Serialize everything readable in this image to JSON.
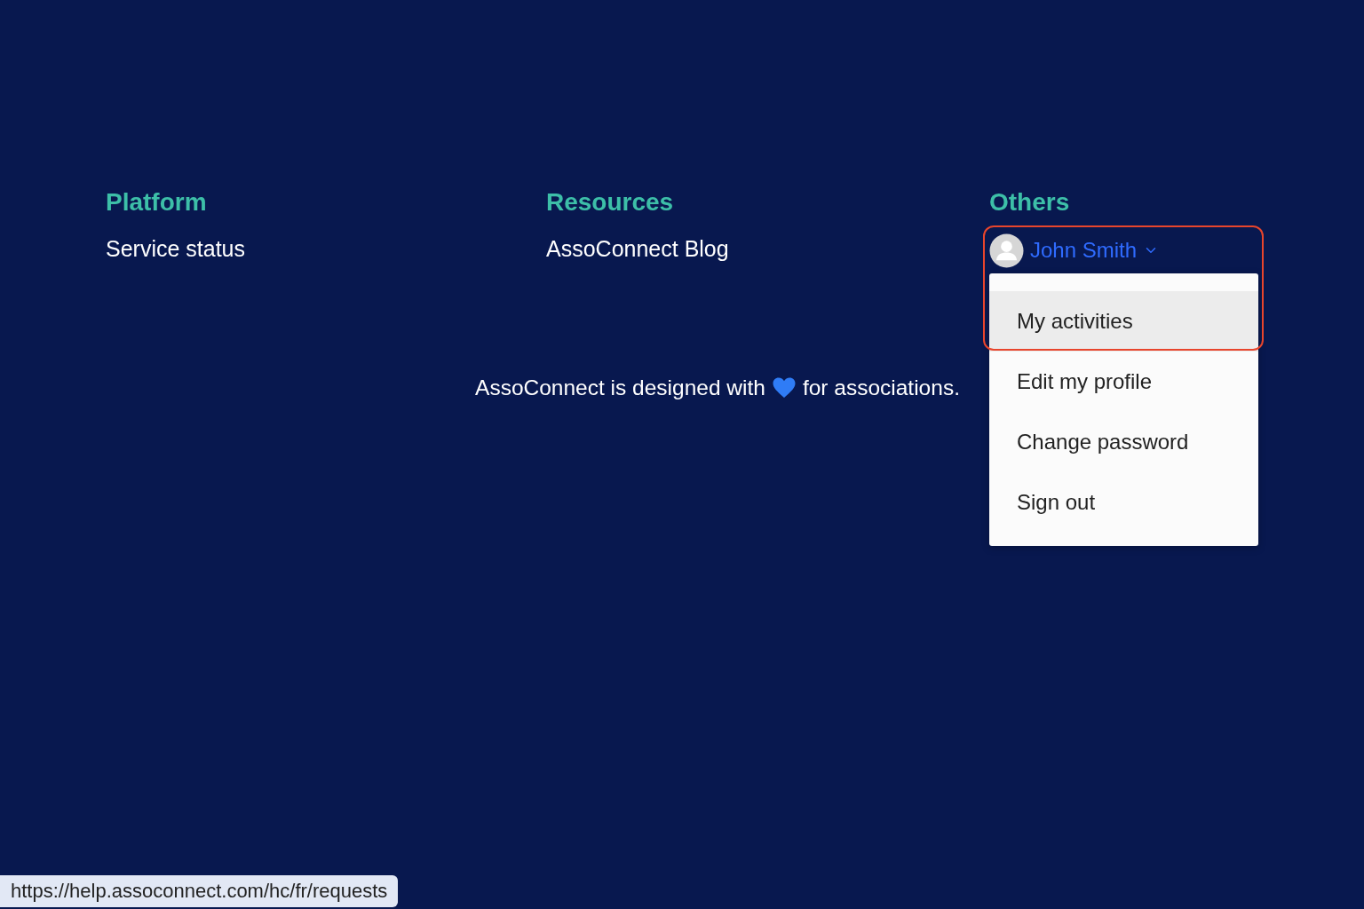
{
  "columns": [
    {
      "kind": "links",
      "heading": "Platform",
      "links": [
        "Service status"
      ]
    },
    {
      "kind": "links",
      "heading": "Resources",
      "links": [
        "AssoConnect Blog"
      ]
    },
    {
      "kind": "account",
      "heading": "Others",
      "user": {
        "name": "John Smith",
        "expanded": true,
        "highlighted": true
      },
      "menu": [
        {
          "label": "My activities",
          "selected": true
        },
        {
          "label": "Edit my profile",
          "selected": false
        },
        {
          "label": "Change password",
          "selected": false
        },
        {
          "label": "Sign out",
          "selected": false
        }
      ]
    }
  ],
  "tagline": {
    "before": "AssoConnect is designed with",
    "after": "for associations."
  },
  "status_bar": {
    "url": "https://help.assoconnect.com/hc/fr/requests"
  }
}
